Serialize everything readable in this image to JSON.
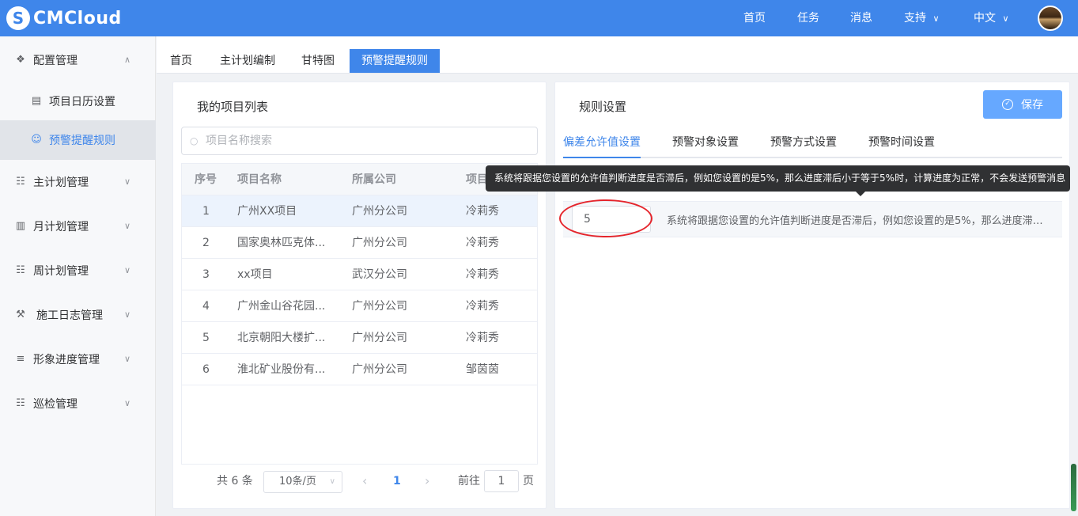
{
  "header": {
    "logo_mark": "S",
    "logo_text": "CMCloud",
    "nav": [
      "首页",
      "任务",
      "消息",
      "支持",
      "中文"
    ]
  },
  "sidebar": {
    "items": [
      {
        "label": "配置管理",
        "icon": "layers-icon"
      },
      {
        "label": "项目日历设置",
        "icon": "calendar-settings-icon"
      },
      {
        "label": "预警提醒规则",
        "icon": "user-icon"
      },
      {
        "label": "主计划管理",
        "icon": "org-chart-icon"
      },
      {
        "label": "月计划管理",
        "icon": "clipboard-icon"
      },
      {
        "label": "周计划管理",
        "icon": "org-chart-icon"
      },
      {
        "label": "施工日志管理",
        "icon": "construction-icon"
      },
      {
        "label": "形象进度管理",
        "icon": "stack-icon"
      },
      {
        "label": "巡检管理",
        "icon": "org-chart-icon"
      }
    ]
  },
  "tabs": [
    "首页",
    "主计划编制",
    "甘特图",
    "预警提醒规则"
  ],
  "left_panel": {
    "title": "我的项目列表",
    "search_placeholder": "项目名称搜索",
    "columns": [
      "序号",
      "项目名称",
      "所属公司",
      "项目"
    ],
    "rows": [
      {
        "no": "1",
        "name": "广州XX项目",
        "company": "广州分公司",
        "manager": "冷莉秀"
      },
      {
        "no": "2",
        "name": "国家奥林匹克体...",
        "company": "广州分公司",
        "manager": "冷莉秀"
      },
      {
        "no": "3",
        "name": "xx项目",
        "company": "武汉分公司",
        "manager": "冷莉秀"
      },
      {
        "no": "4",
        "name": "广州金山谷花园...",
        "company": "广州分公司",
        "manager": "冷莉秀"
      },
      {
        "no": "5",
        "name": "北京朝阳大楼扩...",
        "company": "广州分公司",
        "manager": "冷莉秀"
      },
      {
        "no": "6",
        "name": "淮北矿业股份有...",
        "company": "广州分公司",
        "manager": "邹茵茵"
      }
    ],
    "pagination": {
      "total": "共 6 条",
      "page_size": "10条/页",
      "prev": "‹",
      "current": "1",
      "next": "›",
      "goto_label": "前往",
      "goto_value": "1",
      "page_unit": "页"
    }
  },
  "right_panel": {
    "title": "规则设置",
    "save_label": "保存",
    "tabs": [
      "偏差允许值设置",
      "预警对象设置",
      "预警方式设置",
      "预警时间设置"
    ],
    "tooltip": "系统将跟据您设置的允许值判断进度是否滞后，例如您设置的是5%，那么进度滞后小于等于5%时，计算进度为正常，不会发送预警消息",
    "input_value": "5",
    "rule_text": "系统将跟据您设置的允许值判断进度是否滞后，例如您设置的是5%，那么进度滞后小于等于5%时，计算进度为正常，不会发送预警消息"
  },
  "colors": {
    "primary": "#3f86ea",
    "highlight_circle": "#e5252c",
    "save_button": "#66a8ff"
  }
}
